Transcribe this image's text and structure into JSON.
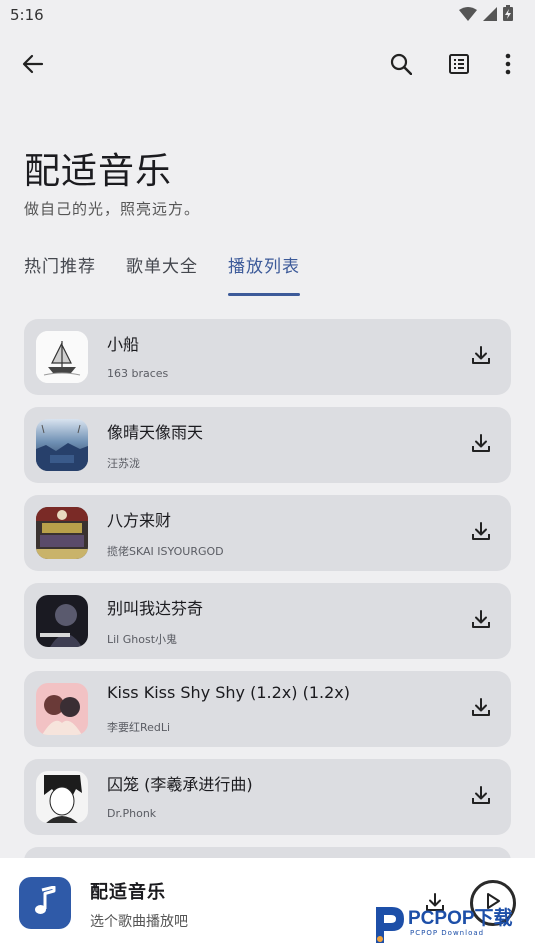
{
  "status_bar": {
    "time": "5:16",
    "icons": [
      "wifi-icon",
      "signal-icon",
      "battery-charging-icon"
    ]
  },
  "app_bar": {
    "icons": [
      "back-arrow-icon",
      "search-icon",
      "list-view-icon",
      "more-vert-icon"
    ]
  },
  "header": {
    "title": "配适音乐",
    "subtitle": "做自己的光，照亮远方。"
  },
  "tabs": [
    {
      "label": "热门推荐",
      "active": false
    },
    {
      "label": "歌单大全",
      "active": false
    },
    {
      "label": "播放列表",
      "active": true
    }
  ],
  "songs": [
    {
      "title": "小船",
      "artist": "163 braces"
    },
    {
      "title": "像晴天像雨天",
      "artist": "汪苏泷"
    },
    {
      "title": "八方来财",
      "artist": "揽佬SKAI ISYOURGOD"
    },
    {
      "title": "别叫我达芬奇",
      "artist": "Lil Ghost小鬼"
    },
    {
      "title": "Kiss Kiss Shy Shy (1.2x) (1.2x)",
      "artist": "李要红RedLi"
    },
    {
      "title": "囚笼 (李羲承进行曲)",
      "artist": "Dr.Phonk"
    }
  ],
  "player": {
    "title": "配适音乐",
    "subtitle": "选个歌曲播放吧",
    "icons": [
      "music-note-icon",
      "download-icon",
      "play-icon"
    ]
  },
  "watermark": {
    "brand": "PCPOP下载",
    "sub": "PCPOP Download"
  },
  "colors": {
    "background": "#efeff1",
    "card": "#dcdde1",
    "accent": "#3c5a99",
    "player_cover": "#2f5aa8"
  }
}
